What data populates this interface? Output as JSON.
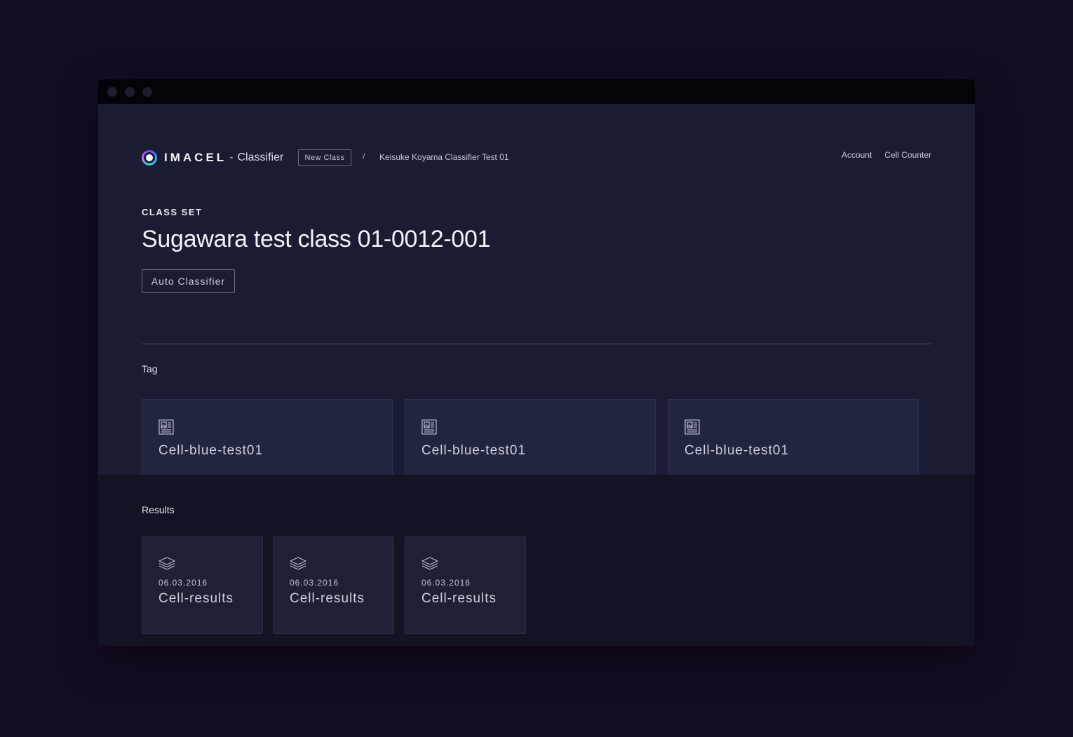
{
  "header": {
    "brand": "IMACEL",
    "separator": "-",
    "product": "Classifier",
    "new_class_label": "New Class",
    "breadcrumb_separator": "/",
    "breadcrumb_item": "Keisuke Koyama Classifier Test 01",
    "nav": [
      "Account",
      "Cell Counter"
    ]
  },
  "class_set": {
    "overline": "CLASS SET",
    "title": "Sugawara test class 01-0012-001",
    "auto_classifier_label": "Auto Classifier"
  },
  "tags": {
    "label": "Tag",
    "items": [
      {
        "name": "Cell-blue-test01",
        "icon": "image-document-icon"
      },
      {
        "name": "Cell-blue-test01",
        "icon": "image-document-icon"
      },
      {
        "name": "Cell-blue-test01",
        "icon": "image-document-icon"
      }
    ]
  },
  "results": {
    "label": "Results",
    "items": [
      {
        "date": "06.03.2016",
        "name": "Cell-results",
        "icon": "layers-icon"
      },
      {
        "date": "06.03.2016",
        "name": "Cell-results",
        "icon": "layers-icon"
      },
      {
        "date": "06.03.2016",
        "name": "Cell-results",
        "icon": "layers-icon"
      }
    ]
  },
  "colors": {
    "page_background": "#150c22",
    "main_panel": "#1a1c33",
    "results_panel": "#121424",
    "card": "#22253f"
  }
}
